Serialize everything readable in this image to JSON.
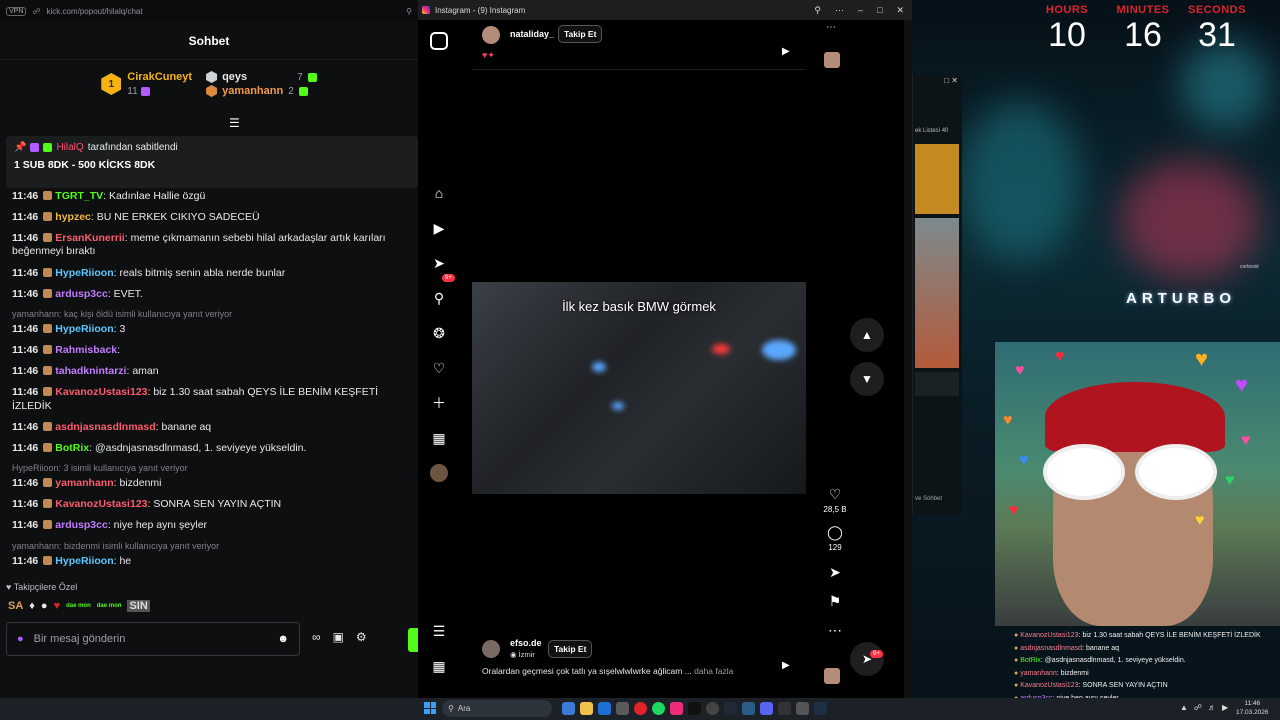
{
  "chat": {
    "url": "kick.com/popout/hilalq/chat",
    "vpn": "VPN",
    "title": "Sohbet",
    "leaderboard": {
      "first": {
        "rank": "1",
        "name": "CirakCuneyt",
        "value": "11"
      },
      "second": {
        "name": "qeys",
        "value": "7"
      },
      "third": {
        "name": "yamanhann",
        "value": "2"
      }
    },
    "pinned": {
      "by_user": "HilalQ",
      "by_suffix": "tarafından sabitlendi",
      "message": "1 SUB 8DK - 500 KİCKS 8DK"
    },
    "messages": [
      {
        "time": "11:46",
        "user": "TGRT_TV",
        "color": "#53fc18",
        "text": "Kadınlae Hallie özgü"
      },
      {
        "time": "11:46",
        "user": "hypzec",
        "color": "#f0b847",
        "text": "BU NE ERKEK CIKIYO SADECEÜ"
      },
      {
        "time": "11:46",
        "user": "ErsanKunerrii",
        "color": "#ff5b6e",
        "text": "meme çıkmamanın sebebi hilal arkadaşlar artık karıları beğenmeyi bıraktı"
      },
      {
        "time": "11:46",
        "user": "HypeRiioon",
        "color": "#5cc8ff",
        "text": "reals bitmiş senin abla nerde bunlar"
      },
      {
        "time": "11:46",
        "user": "ardusp3cc",
        "color": "#c27cff",
        "text": "EVET."
      },
      {
        "reply": "yamanhann: kaç kişi öldü isimli kullanıcıya yanıt veriyor",
        "time": "11:46",
        "user": "HypeRiioon",
        "color": "#5cc8ff",
        "text": "3"
      },
      {
        "time": "11:46",
        "user": "Rahmisback",
        "color": "#c27cff",
        "text": ""
      },
      {
        "time": "11:46",
        "user": "tahadknintarzi",
        "color": "#c27cff",
        "text": "aman"
      },
      {
        "time": "11:46",
        "user": "KavanozUstasi123",
        "color": "#ff5b6e",
        "text": "biz 1.30 saat sabah QEYS İLE BENİM KEŞFETİ İZLEDİK"
      },
      {
        "time": "11:46",
        "user": "asdnjasnasdlnmasd",
        "color": "#ff5b6e",
        "text": "banane aq"
      },
      {
        "time": "11:46",
        "user": "BotRix",
        "color": "#53fc18",
        "text": "@asdnjasnasdlnmasd, 1. seviyeye yükseldin."
      },
      {
        "reply": "HypeRiioon: 3 isimli kullanıcıya yanıt veriyor",
        "time": "11:46",
        "user": "yamanhann",
        "color": "#ff5b6e",
        "text": "bizdenmi"
      },
      {
        "time": "11:46",
        "user": "KavanozUstasi123",
        "color": "#ff5b6e",
        "text": "SONRA SEN YAYIN AÇTIN"
      },
      {
        "time": "11:46",
        "user": "ardusp3cc",
        "color": "#c27cff",
        "text": "niye hep aynı şeyler"
      },
      {
        "reply": "yamanhann: bizdenmi isimli kullanıcıya yanıt veriyor",
        "time": "11:46",
        "user": "HypeRiioon",
        "color": "#5cc8ff",
        "text": "he"
      }
    ],
    "followers_only": "Takipçilere Özel",
    "emotes": [
      "SA",
      "dae mon",
      "dae mon",
      "SIN"
    ],
    "input_placeholder": "Bir mesaj gönderin"
  },
  "instagram": {
    "window_title": "Instagram - (9) Instagram",
    "notif_badge": "9+",
    "top_post": {
      "user": "nataliday_",
      "follow": "Takip Et"
    },
    "reel_overlay": "İlk kez basık BMW görmek",
    "likes": "28,5 B",
    "comments": "129",
    "bottom_post": {
      "user": "efso.de",
      "location": "İzmir",
      "follow": "Takip Et",
      "caption": "Oralardan geçmesi çok tatlı ya sışelwlwlwrke ağlicam ...",
      "more": "daha fazla"
    },
    "fab_badge": "9+"
  },
  "midapp": {
    "list_label": "ek Listesi",
    "list_count": "40",
    "footer": "ve Sohbet"
  },
  "timer": {
    "hours_label": "HOURS",
    "hours": "10",
    "minutes_label": "MINUTES",
    "minutes": "16",
    "seconds_label": "SECONDS",
    "seconds": "31"
  },
  "stream": {
    "brand": "ARTURBO",
    "small_label": "cortexist"
  },
  "overlay_chat": [
    {
      "user": "KavanozUstasi123",
      "color": "#ff7b8e",
      "text": ": biz 1.30 saat sabah QEYS İLE BENİM KEŞFETİ İZLEDİK"
    },
    {
      "user": "asdnjasnasdlnmasd",
      "color": "#ff7b8e",
      "text": ": banane aq"
    },
    {
      "user": "BotRix",
      "color": "#53fc18",
      "text": ": @asdnjasnasdlnmasd, 1. seviyeye yükseldin."
    },
    {
      "user": "yamanhann",
      "color": "#ff7b8e",
      "text": ": bizdenmi"
    },
    {
      "user": "KavanozUstasi123",
      "color": "#ff7b8e",
      "text": ": SONRA SEN YAYIN AÇTIN"
    },
    {
      "user": "ardusp3cc",
      "color": "#c27cff",
      "text": ": niye hep aynı şeyler"
    },
    {
      "user": "HypeRiioon",
      "color": "#5cc8ff",
      "text": ": he"
    }
  ],
  "taskbar": {
    "search": "Ara",
    "time": "11:46",
    "date": "17.03.2026"
  }
}
